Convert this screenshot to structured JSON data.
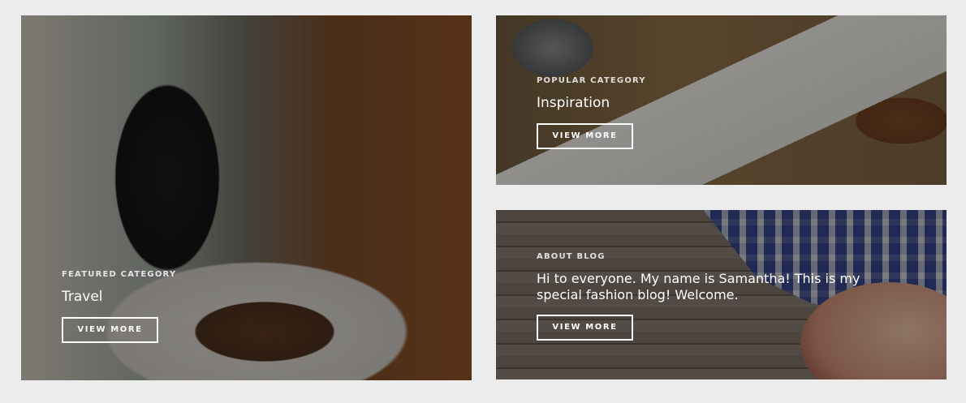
{
  "cards": {
    "featured": {
      "eyebrow": "FEATURED CATEGORY",
      "title": "Travel",
      "button": "VIEW MORE"
    },
    "popular": {
      "eyebrow": "POPULAR CATEGORY",
      "title": "Inspiration",
      "button": "VIEW MORE"
    },
    "about": {
      "eyebrow": "ABOUT BLOG",
      "title": "Hi to everyone. My name is Samantha! This is my special fashion blog! Welcome.",
      "button": "VIEW MORE"
    }
  },
  "colors": {
    "background": "#ececec",
    "text": "#ffffff",
    "overlay": "rgba(0,0,0,0.38)"
  }
}
